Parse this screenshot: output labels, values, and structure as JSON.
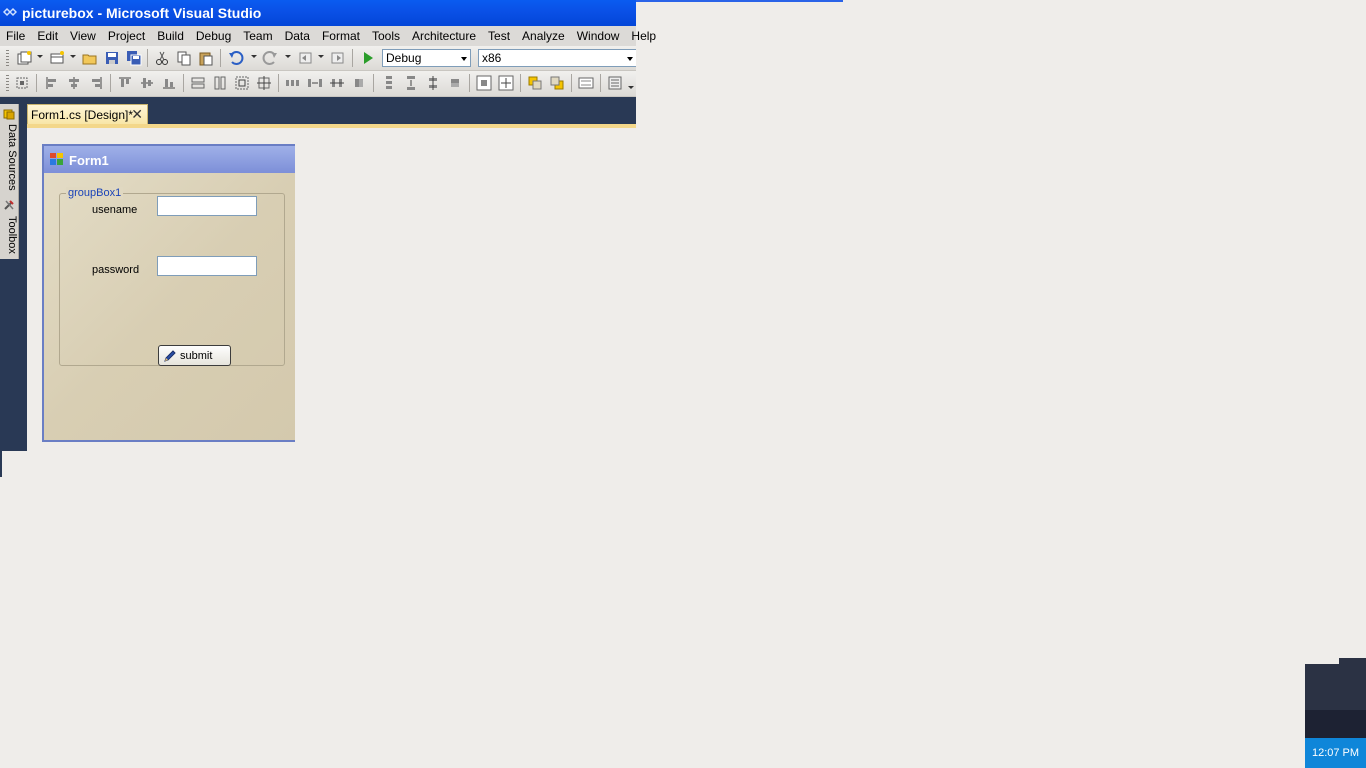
{
  "window": {
    "title": "picturebox - Microsoft Visual Studio"
  },
  "menu": {
    "items": [
      "File",
      "Edit",
      "View",
      "Project",
      "Build",
      "Debug",
      "Team",
      "Data",
      "Format",
      "Tools",
      "Architecture",
      "Test",
      "Analyze",
      "Window",
      "Help"
    ]
  },
  "toolbar": {
    "config_value": "Debug",
    "platform_value": "x86"
  },
  "side_tabs": {
    "data_sources": "Data Sources",
    "toolbox": "Toolbox"
  },
  "document_tab": {
    "label": "Form1.cs [Design]*",
    "close": "✕"
  },
  "form": {
    "title": "Form1",
    "groupbox_caption": "groupBox1",
    "username_label": "usename",
    "username_value": "",
    "password_label": "password",
    "password_value": "",
    "submit_label": "submit"
  },
  "taskbar": {
    "clock": "12:07 PM"
  },
  "colors": {
    "titlebar": "#0a50e6",
    "ide_background": "#293955",
    "tab_accent": "#f3d78a",
    "form_titlebar": "#7d8fd8"
  }
}
